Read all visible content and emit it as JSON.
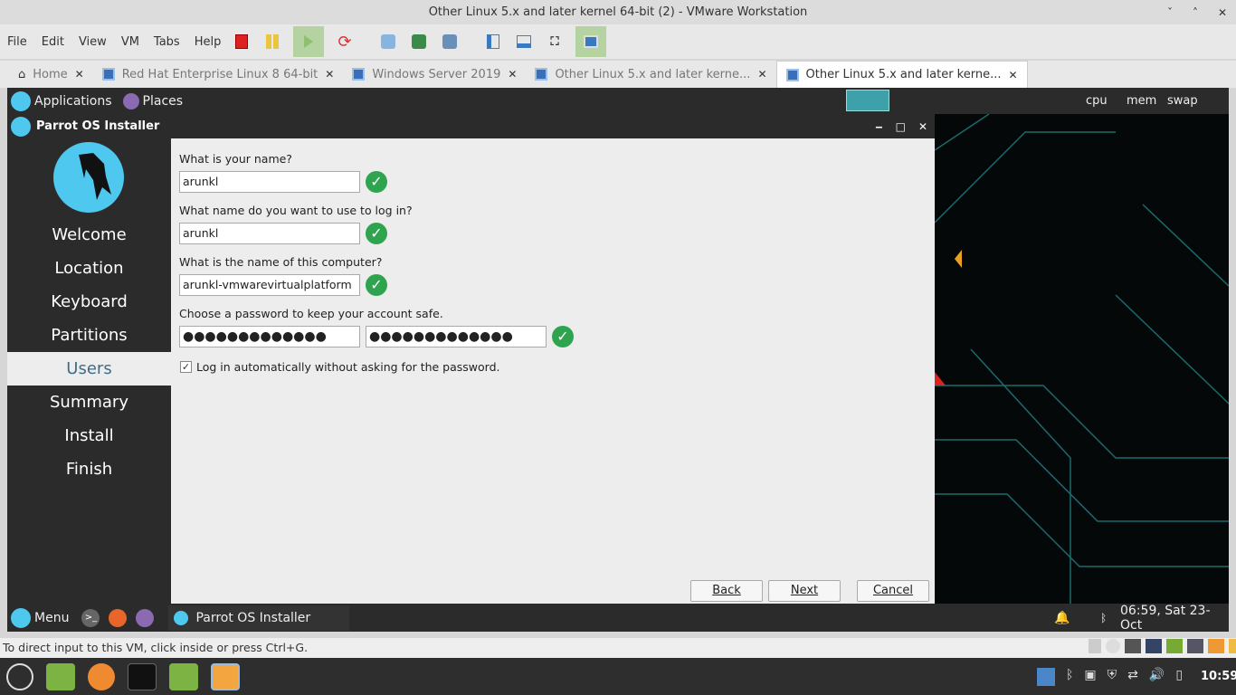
{
  "window": {
    "title": "Other Linux 5.x and later kernel 64-bit (2) - VMware Workstation"
  },
  "menu": [
    "File",
    "Edit",
    "View",
    "VM",
    "Tabs",
    "Help"
  ],
  "tabs": [
    {
      "label": "Home",
      "icon": "home-icon"
    },
    {
      "label": "Red Hat Enterprise Linux 8 64-bit"
    },
    {
      "label": "Windows Server 2019"
    },
    {
      "label": "Other Linux 5.x and later kerne..."
    },
    {
      "label": "Other Linux 5.x and later kerne...",
      "active": true
    }
  ],
  "guest_top": {
    "applications": "Applications",
    "places": "Places",
    "cpu": "cpu",
    "mem": "mem",
    "swap": "swap"
  },
  "installer": {
    "title": "Parrot OS Installer",
    "steps": [
      "Welcome",
      "Location",
      "Keyboard",
      "Partitions",
      "Users",
      "Summary",
      "Install",
      "Finish"
    ],
    "active_step": "Users",
    "name_label": "What is your name?",
    "name_value": "arunkl",
    "login_label": "What name do you want to use to log in?",
    "login_value": "arunkl",
    "computer_label": "What is the name of this computer?",
    "computer_value": "arunkl-vmwarevirtualplatform",
    "password_label": "Choose a password to keep your account safe.",
    "password_mask": "●●●●●●●●●●●●●",
    "password_confirm_mask": "●●●●●●●●●●●●●",
    "autologin_label": "Log in automatically without asking for the password.",
    "autologin_checked": true,
    "back": "Back",
    "next": "Next",
    "cancel": "Cancel"
  },
  "guest_bottom": {
    "menu": "Menu",
    "task": "Parrot OS Installer",
    "clock": "06:59, Sat 23-Oct"
  },
  "statusbar": "To direct input to this VM, click inside or press Ctrl+G.",
  "host_clock": "10:59",
  "colors": {
    "parrot": "#4fc8ef",
    "check": "#2ea44f",
    "active_step_text": "#3e6c86"
  }
}
